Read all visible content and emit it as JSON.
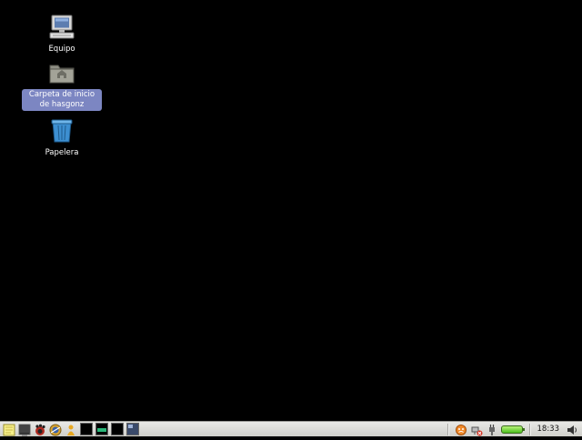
{
  "desktop": {
    "icons": [
      {
        "label": "Equipo",
        "icon": "computer-icon"
      },
      {
        "label": "Carpeta de inicio de hasgonz",
        "icon": "home-folder-icon",
        "selected": true
      },
      {
        "label": "Papelera",
        "icon": "trash-icon"
      }
    ]
  },
  "taskbar": {
    "launchers": [
      "notes-icon",
      "terminal-icon",
      "gnome-foot-icon",
      "globe-icon",
      "user-icon",
      "workspace-1",
      "workspace-2",
      "workspace-3",
      "workspace-4"
    ],
    "tray": {
      "icons": [
        "update-notifier-icon",
        "network-disconnected-icon",
        "power-plug-icon",
        "battery-icon",
        "volume-icon"
      ],
      "clock": "18:33"
    }
  },
  "colors": {
    "desktop_bg": "#000000",
    "selection": "#7c86c2",
    "taskbar_bg": "#dcdcd8"
  }
}
